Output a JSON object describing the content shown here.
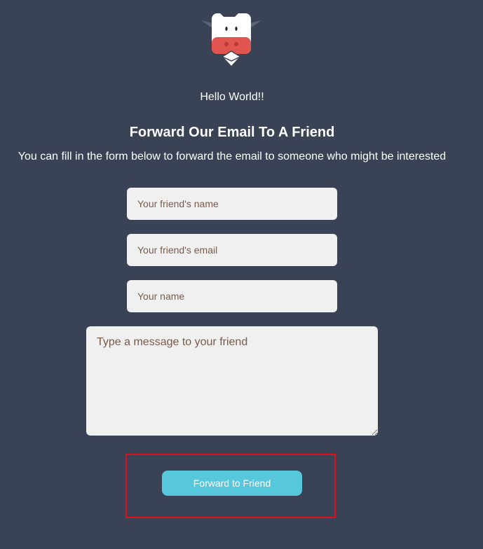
{
  "header": {
    "logo_icon": "cow-mascot-icon",
    "greeting": "Hello World!!"
  },
  "main": {
    "title": "Forward Our Email To A Friend",
    "subtitle": "You can fill in the form below to forward the email to someone who might be interested"
  },
  "form": {
    "friend_name_placeholder": "Your friend's name",
    "friend_email_placeholder": "Your friend's email",
    "your_name_placeholder": "Your name",
    "message_placeholder": "Type a message to your friend",
    "submit_label": "Forward to Friend"
  },
  "colors": {
    "background": "#3a4256",
    "button": "#57c8db",
    "input_bg": "#f0f0f0",
    "highlight": "#e0101a"
  }
}
